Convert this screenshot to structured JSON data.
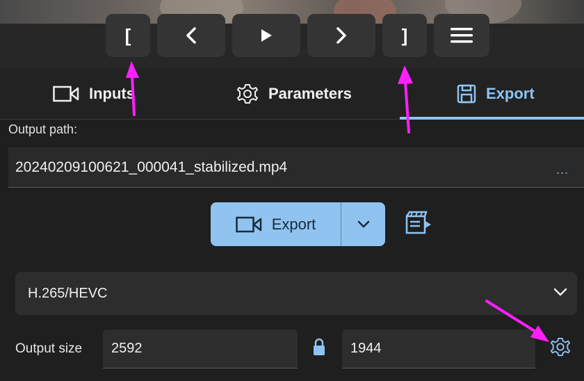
{
  "toolbar": {
    "mark_in_label": "[",
    "mark_out_label": "]",
    "prev_icon": "chevron-left-icon",
    "play_icon": "play-icon",
    "next_icon": "chevron-right-icon",
    "menu_icon": "hamburger-menu-icon"
  },
  "tabs": [
    {
      "label": "Inputs",
      "icon": "video-camera-icon",
      "active": false
    },
    {
      "label": "Parameters",
      "icon": "gear-icon",
      "active": false
    },
    {
      "label": "Export",
      "icon": "floppy-disk-icon",
      "active": true
    }
  ],
  "export": {
    "output_path_label": "Output path:",
    "output_path_value": "20240209100621_000041_stabilized.mp4",
    "browse_label": "...",
    "export_button_label": "Export",
    "codec_selected": "H.265/HEVC",
    "output_size_label": "Output size",
    "width": "2592",
    "height": "1944"
  },
  "colors": {
    "accent": "#8fc4f2",
    "button_bg": "#90c3ef",
    "annotation": "#ff1fff",
    "background": "#1f1f1f"
  }
}
